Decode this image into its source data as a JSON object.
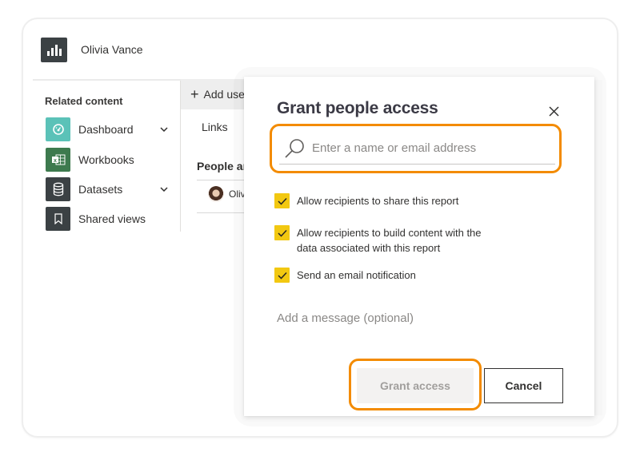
{
  "app": {
    "user_name": "Olivia Vance",
    "logo_icon": "bar-chart-icon"
  },
  "sidebar": {
    "title": "Related content",
    "items": [
      {
        "label": "Dashboard",
        "icon": "dashboard-gauge-icon",
        "icon_color": "#5bc2b8",
        "expandable": true
      },
      {
        "label": "Workbooks",
        "icon": "excel-workbook-icon",
        "icon_color": "#3d7a4e",
        "expandable": false
      },
      {
        "label": "Datasets",
        "icon": "database-icon",
        "icon_color": "#3b4144",
        "expandable": true
      },
      {
        "label": "Shared views",
        "icon": "bookmark-icon",
        "icon_color": "#3b4144",
        "expandable": false
      }
    ]
  },
  "background_panel": {
    "add_user_label": "Add use",
    "links_tab": "Links",
    "people_header": "People ar",
    "people": [
      {
        "name": "Olivi"
      }
    ]
  },
  "dialog": {
    "title": "Grant people access",
    "close_icon": "close-icon",
    "search": {
      "placeholder": "Enter a name or email address",
      "value": ""
    },
    "options": [
      {
        "label": "Allow recipients to share this report",
        "checked": true
      },
      {
        "label": "Allow recipients to build content with the data associated with this report",
        "checked": true
      },
      {
        "label": "Send an email notification",
        "checked": true
      }
    ],
    "message_placeholder": "Add a message (optional)",
    "grant_button": "Grant access",
    "grant_enabled": false,
    "cancel_button": "Cancel"
  },
  "colors": {
    "highlight": "#f38b00",
    "checkbox": "#f2c811",
    "dashboard_icon": "#5bc2b8",
    "workbook_icon": "#3d7a4e",
    "dark_icon": "#3b4144"
  }
}
